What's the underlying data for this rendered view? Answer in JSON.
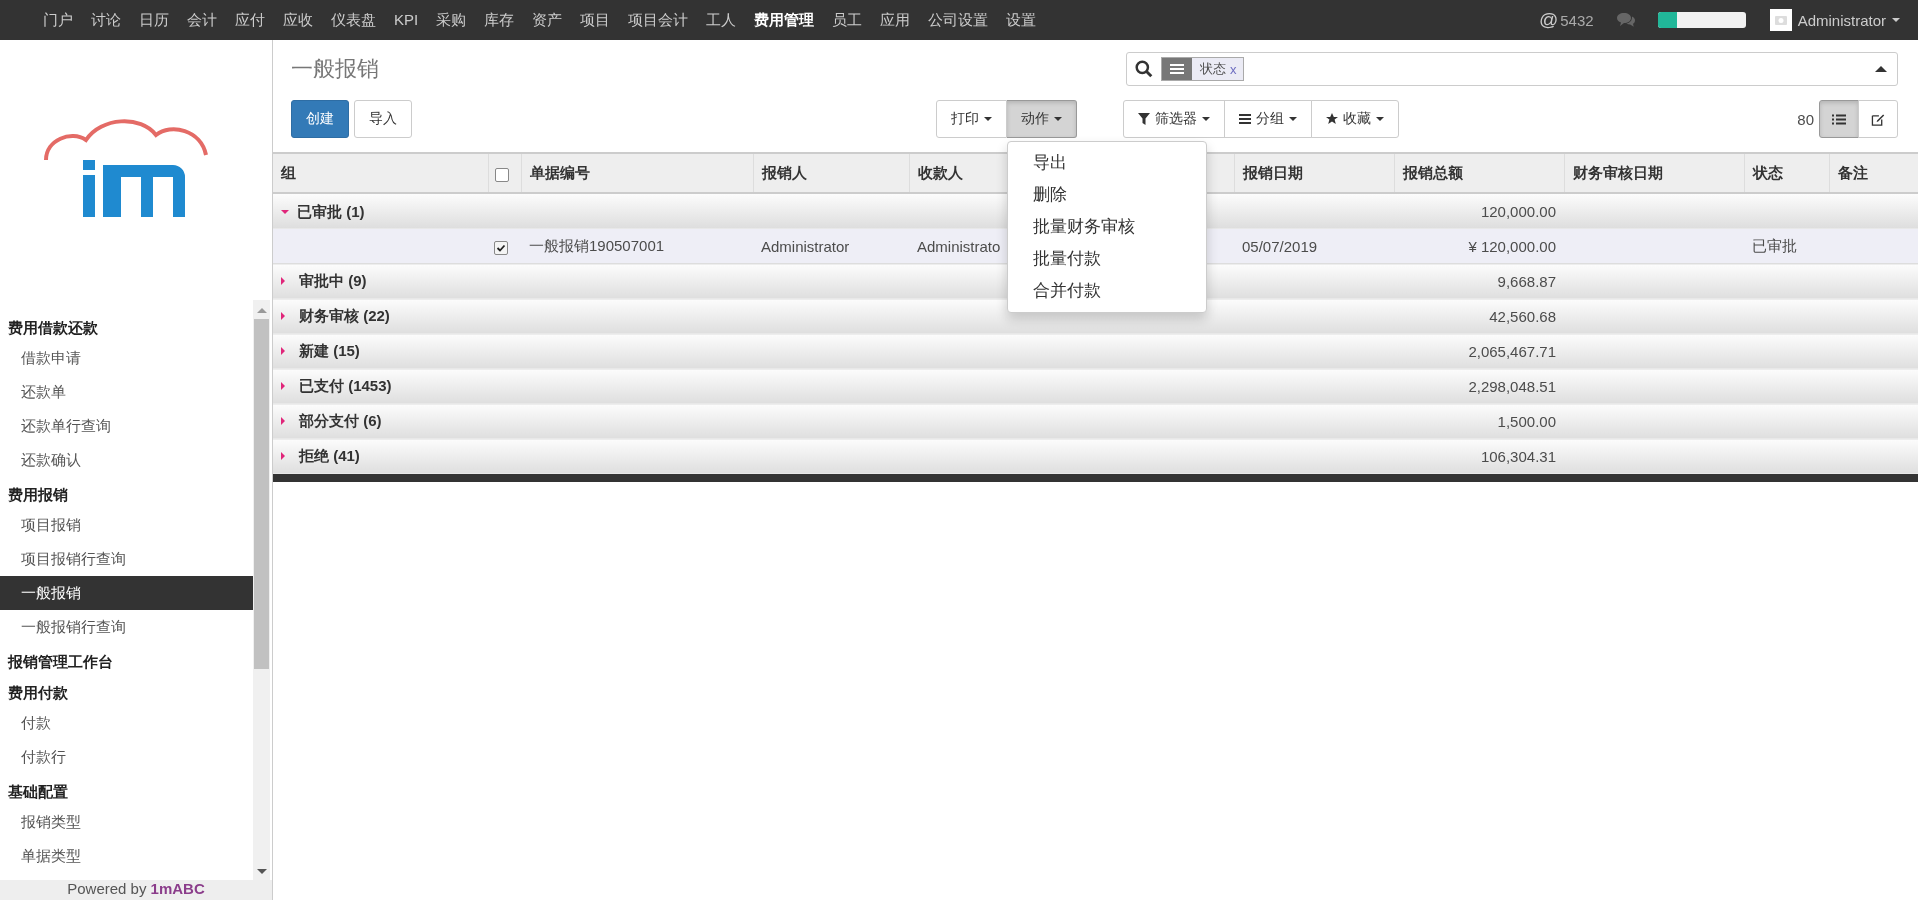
{
  "top_nav": {
    "items": [
      {
        "label": "门户",
        "selected": false
      },
      {
        "label": "讨论",
        "selected": false
      },
      {
        "label": "日历",
        "selected": false
      },
      {
        "label": "会计",
        "selected": false
      },
      {
        "label": "应付",
        "selected": false
      },
      {
        "label": "应收",
        "selected": false
      },
      {
        "label": "仪表盘",
        "selected": false
      },
      {
        "label": "KPI",
        "selected": false
      },
      {
        "label": "采购",
        "selected": false
      },
      {
        "label": "库存",
        "selected": false
      },
      {
        "label": "资产",
        "selected": false
      },
      {
        "label": "项目",
        "selected": false
      },
      {
        "label": "项目会计",
        "selected": false
      },
      {
        "label": "工人",
        "selected": false
      },
      {
        "label": "费用管理",
        "selected": true
      },
      {
        "label": "员工",
        "selected": false
      },
      {
        "label": "应用",
        "selected": false
      },
      {
        "label": "公司设置",
        "selected": false
      },
      {
        "label": "设置",
        "selected": false
      }
    ],
    "mention_icon": "@",
    "mentions": "5432",
    "progress": {
      "level": 0.22
    },
    "user": "Administrator"
  },
  "sidebar": {
    "sections": [
      {
        "title": "费用借款还款",
        "items": [
          {
            "label": "借款申请",
            "selected": false
          },
          {
            "label": "还款单",
            "selected": false
          },
          {
            "label": "还款单行查询",
            "selected": false
          },
          {
            "label": "还款确认",
            "selected": false
          }
        ]
      },
      {
        "title": "费用报销",
        "items": [
          {
            "label": "项目报销",
            "selected": false
          },
          {
            "label": "项目报销行查询",
            "selected": false
          },
          {
            "label": "一般报销",
            "selected": true
          },
          {
            "label": "一般报销行查询",
            "selected": false
          }
        ]
      },
      {
        "title": "报销管理工作台"
      },
      {
        "title": "费用付款",
        "items": [
          {
            "label": "付款",
            "selected": false
          },
          {
            "label": "付款行",
            "selected": false
          }
        ]
      },
      {
        "title": "基础配置",
        "items": [
          {
            "label": "报销类型",
            "selected": false
          },
          {
            "label": "单据类型",
            "selected": false
          }
        ]
      }
    ],
    "footer": "Powered by **1mABC**"
  },
  "page": {
    "title": "一般报销",
    "create_button": "创建",
    "import_button": "导入",
    "print_button": "打印",
    "action_button": {
      "label": "动作",
      "expanded": true
    },
    "action_menu": [
      "导出",
      "删除",
      "批量财务审核",
      "批量付款",
      "合并付款"
    ],
    "search": {
      "facet": "状态",
      "facet_remove": "x"
    },
    "filters": [
      {
        "kind": "filter",
        "label": "筛选器"
      },
      {
        "kind": "group",
        "label": "分组"
      },
      {
        "kind": "favorite",
        "label": "收藏"
      }
    ],
    "pager": "80",
    "views": [
      {
        "kind": "list",
        "selected": true
      },
      {
        "kind": "form",
        "selected": false
      }
    ]
  },
  "table": {
    "select_all_checked": false,
    "columns": [
      "组",
      "单据编号",
      "报销人",
      "收款人",
      "报销日期",
      "报销总额",
      "财务审核日期",
      "状态",
      "备注"
    ],
    "groups": [
      {
        "label": "已审批 (1)",
        "expanded": true,
        "total": "120,000.00",
        "rows": [
          {
            "checked": true,
            "number": "一般报销190507001",
            "submitter": "Administrator",
            "payee": "Administrato",
            "date": "05/07/2019",
            "amount": "¥ 120,000.00",
            "status": "已审批"
          }
        ]
      },
      {
        "label": "审批中 (9)",
        "expanded": false,
        "total": "9,668.87"
      },
      {
        "label": "财务审核 (22)",
        "expanded": false,
        "total": "42,560.68"
      },
      {
        "label": "新建 (15)",
        "expanded": false,
        "total": "2,065,467.71"
      },
      {
        "label": "已支付 (1453)",
        "expanded": false,
        "total": "2,298,048.51"
      },
      {
        "label": "部分支付 (6)",
        "expanded": false,
        "total": "1,500.00"
      },
      {
        "label": "拒绝 (41)",
        "expanded": false,
        "total": "106,304.31"
      }
    ]
  }
}
